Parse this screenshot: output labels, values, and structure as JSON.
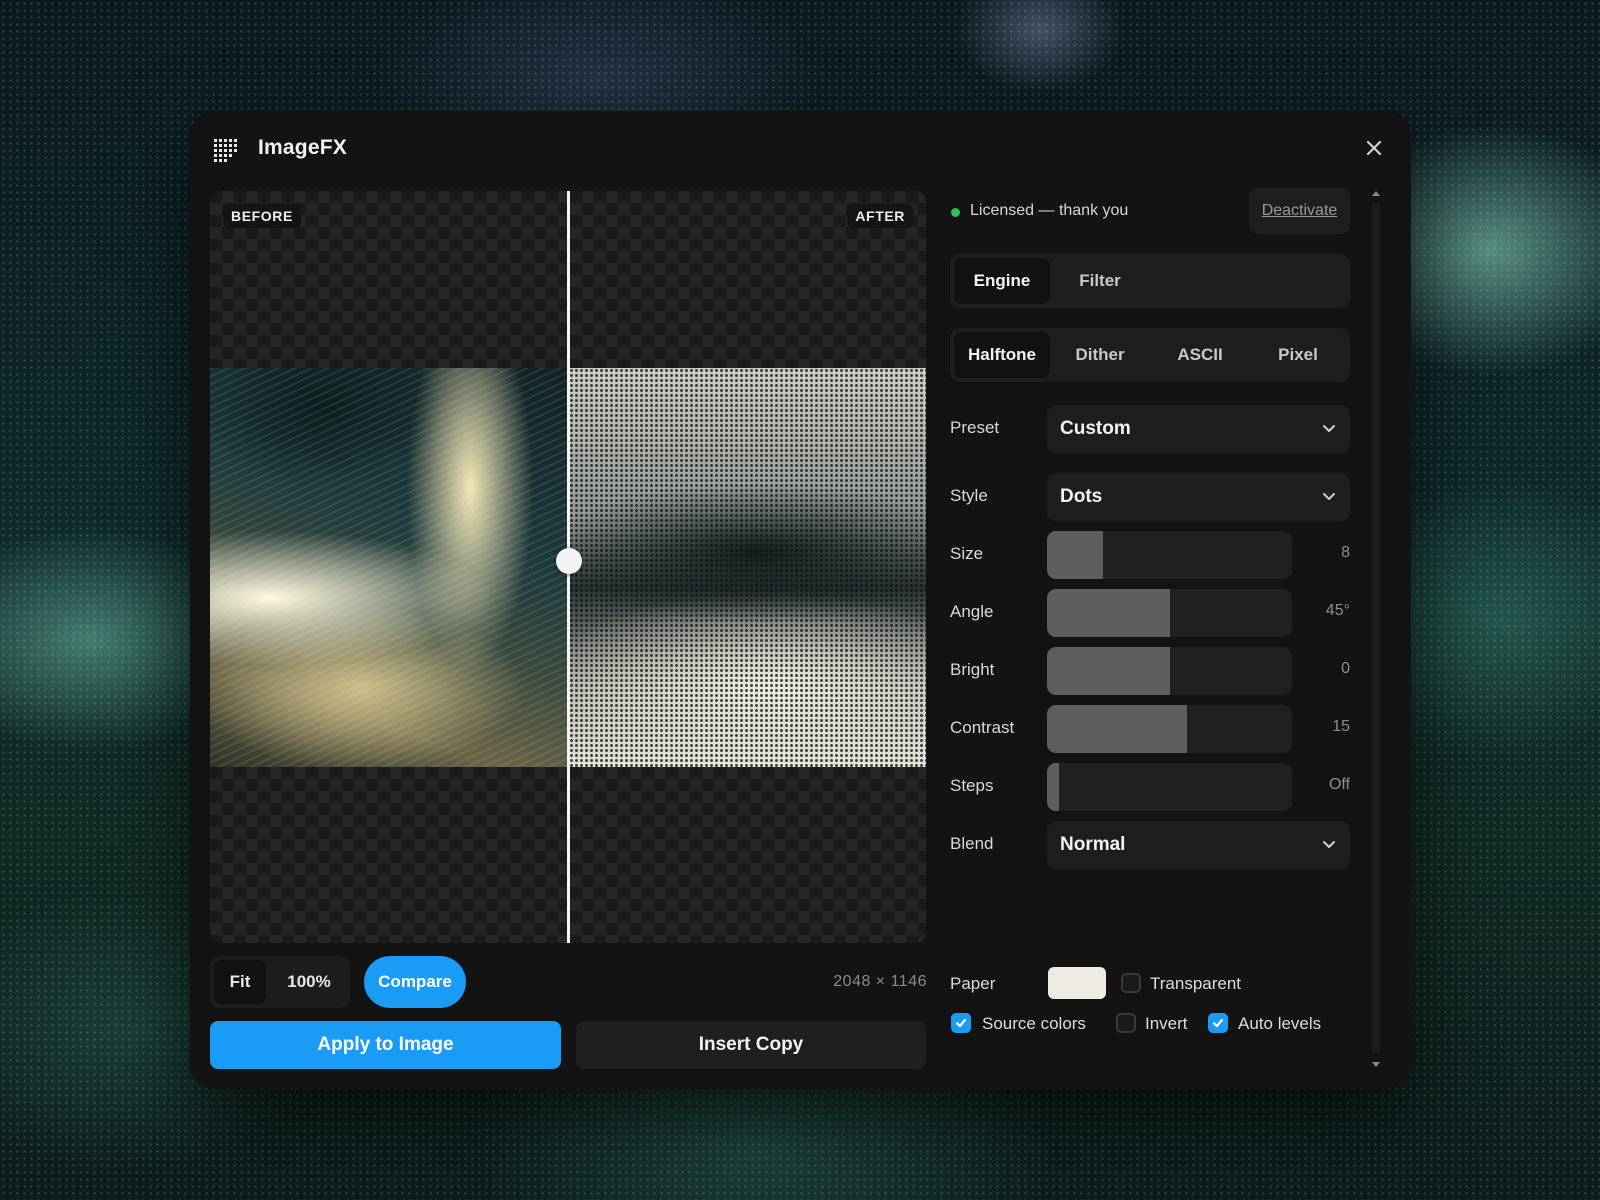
{
  "window": {
    "title": "ImageFX",
    "close_icon": "close-icon",
    "logo_icon": "grid-logo-icon"
  },
  "preview": {
    "before_label": "BEFORE",
    "after_label": "AFTER",
    "split_position": 0.5,
    "zoom_fit_label": "Fit",
    "zoom_100_label": "100%",
    "compare_label": "Compare",
    "dimensions": "2048 × 1146",
    "apply_label": "Apply to Image",
    "insert_label": "Insert Copy"
  },
  "license": {
    "status": "Licensed — thank you",
    "deactivate_label": "Deactivate",
    "status_color": "#2fbf57"
  },
  "tabs": [
    {
      "label": "Engine",
      "active": true
    },
    {
      "label": "Filter",
      "active": false
    }
  ],
  "modes": [
    {
      "label": "Halftone",
      "active": true
    },
    {
      "label": "Dither",
      "active": false
    },
    {
      "label": "ASCII",
      "active": false
    },
    {
      "label": "Pixel",
      "active": false
    }
  ],
  "preset": {
    "label": "Preset",
    "value": "Custom"
  },
  "style": {
    "label": "Style",
    "value": "Dots"
  },
  "sliders": {
    "size": {
      "label": "Size",
      "value": "8",
      "fill": 0.23
    },
    "angle": {
      "label": "Angle",
      "value": "45°",
      "fill": 0.5
    },
    "bright": {
      "label": "Bright",
      "value": "0",
      "fill": 0.5
    },
    "contrast": {
      "label": "Contrast",
      "value": "15",
      "fill": 0.57
    },
    "steps": {
      "label": "Steps",
      "value": "Off",
      "fill": 0.05
    }
  },
  "blend": {
    "label": "Blend",
    "value": "Normal"
  },
  "paper": {
    "label": "Paper",
    "color": "#efeae2",
    "transparent_label": "Transparent",
    "transparent_checked": false
  },
  "options": {
    "source_colors": {
      "label": "Source colors",
      "checked": true
    },
    "invert": {
      "label": "Invert",
      "checked": false
    },
    "auto_levels": {
      "label": "Auto levels",
      "checked": true
    }
  },
  "accent_color": "#1a9bf6"
}
